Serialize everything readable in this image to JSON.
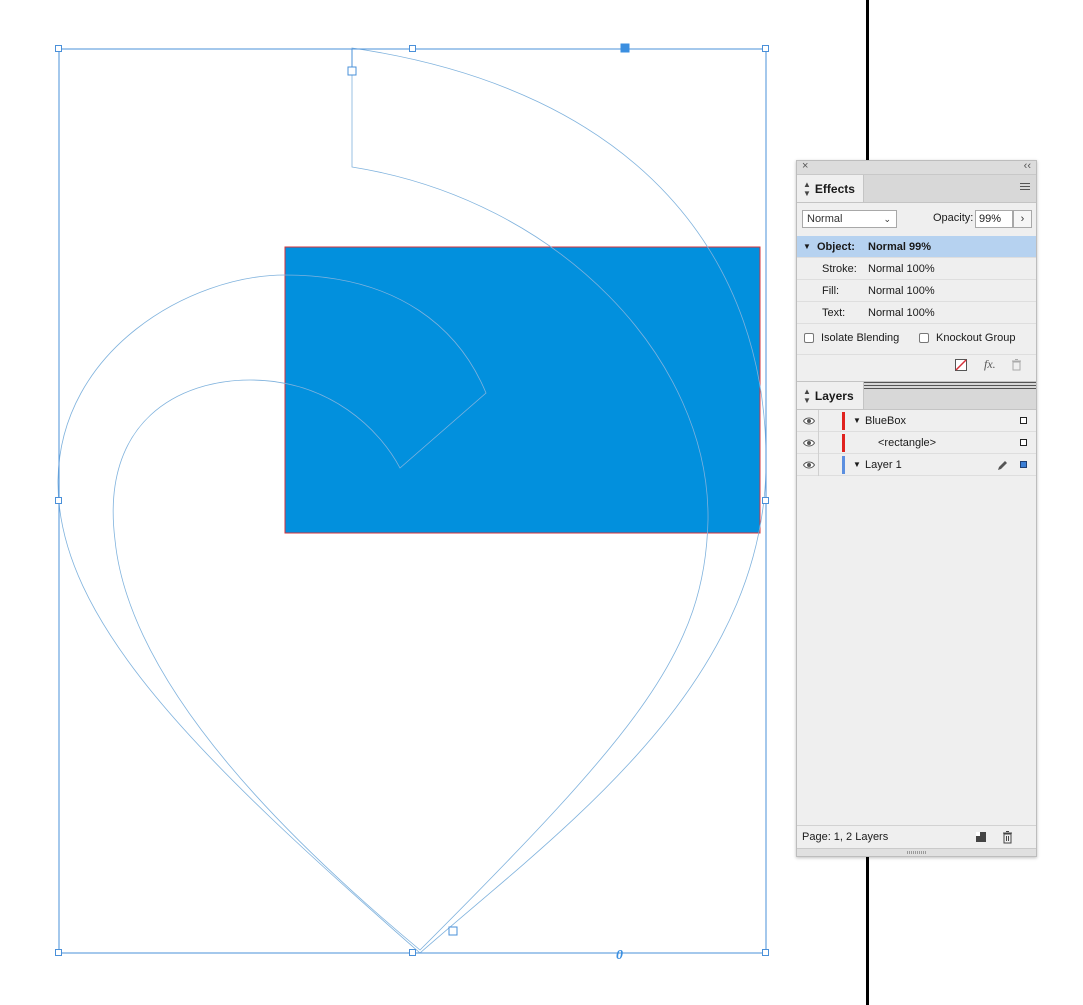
{
  "canvas": {
    "frame_color": "#4a90d9",
    "outline_color": "#7fb2dd",
    "rectangle_fill": "#0290dd",
    "rectangle_stroke": "#d6323a",
    "handle_fill": "#3b8fe0",
    "rotation_label": "0"
  },
  "panel": {
    "effects_tab": {
      "label": "Effects"
    },
    "blend_mode": "Normal",
    "opacity_label": "Opacity:",
    "opacity_value": "99%",
    "effect_rows": [
      {
        "label": "Object:",
        "value": "Normal 99%",
        "selected": true
      },
      {
        "label": "Stroke:",
        "value": "Normal 100%"
      },
      {
        "label": "Fill:",
        "value": "Normal 100%"
      },
      {
        "label": "Text:",
        "value": "Normal 100%"
      }
    ],
    "isolate_blending_label": "Isolate Blending",
    "knockout_group_label": "Knockout Group",
    "fx_label": "fx.",
    "layers_tab": {
      "label": "Layers"
    },
    "layers": [
      {
        "name": "BlueBox",
        "color": "#e0221e",
        "expanded": true
      },
      {
        "name": "<rectangle>",
        "color": "#e0221e",
        "child": true
      },
      {
        "name": "Layer 1",
        "color": "#5b8fe0",
        "expanded": true,
        "filled": true
      }
    ],
    "layers_status": "Page: 1, 2 Layers"
  }
}
